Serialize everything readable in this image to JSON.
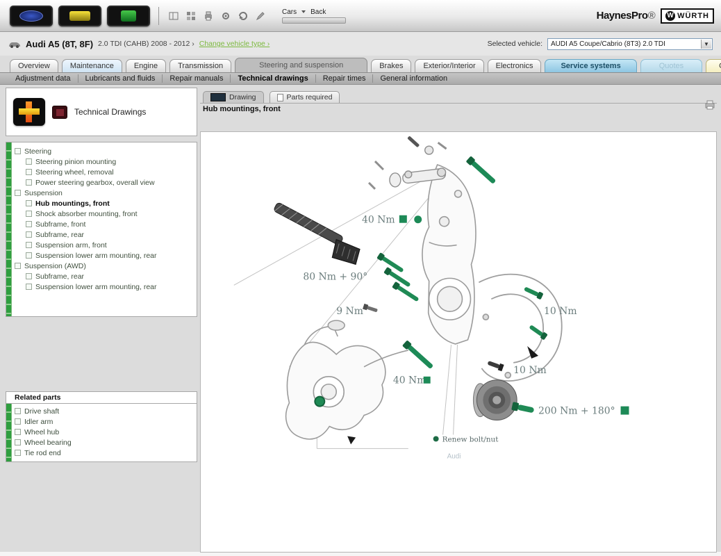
{
  "toolbar": {
    "cars_link": "Cars",
    "back_link": "Back",
    "haynes_logo": "HaynesPro",
    "partner_logo": "WÜRTH",
    "partner_q": "W"
  },
  "vehicle": {
    "title": "Audi A5 (8T, 8F)",
    "subtitle": "2.0 TDI (CAHB) 2008 - 2012 ›",
    "change_link": "Change vehicle type ›",
    "selected_label": "Selected vehicle:",
    "selected_value": "AUDI A5 Coupe/Cabrio (8T3) 2.0 TDI"
  },
  "tabs": [
    {
      "label": "Overview"
    },
    {
      "label": "Maintenance"
    },
    {
      "label": "Engine"
    },
    {
      "label": "Transmission"
    },
    {
      "label": "Steering and suspension"
    },
    {
      "label": "Brakes"
    },
    {
      "label": "Exterior/Interior"
    },
    {
      "label": "Electronics"
    },
    {
      "label": "Service systems"
    },
    {
      "label": "Quotes"
    },
    {
      "label": "Order"
    }
  ],
  "subtabs": [
    {
      "label": "Adjustment data"
    },
    {
      "label": "Lubricants and fluids"
    },
    {
      "label": "Repair manuals"
    },
    {
      "label": "Technical drawings"
    },
    {
      "label": "Repair times"
    },
    {
      "label": "General information"
    }
  ],
  "sidebar": {
    "title": "Technical Drawings",
    "tree": [
      {
        "label": "Steering",
        "items": [
          "Steering pinion mounting",
          "Steering wheel, removal",
          "Power steering gearbox, overall view"
        ]
      },
      {
        "label": "Suspension",
        "items": [
          "Hub mountings, front",
          "Shock absorber mounting, front",
          "Subframe, front",
          "Subframe, rear",
          "Suspension arm, front",
          "Suspension lower arm mounting, rear"
        ]
      },
      {
        "label": "Suspension (AWD)",
        "items": [
          "Subframe, rear",
          "Suspension lower arm mounting, rear"
        ]
      }
    ],
    "related": {
      "title": "Related parts",
      "items": [
        "Drive shaft",
        "Idler arm",
        "Wheel hub",
        "Wheel bearing",
        "Tie rod end"
      ]
    }
  },
  "main": {
    "tabs": [
      {
        "label": "Drawing"
      },
      {
        "label": "Parts required"
      }
    ],
    "title": "Hub mountings, front"
  },
  "drawing": {
    "torques": [
      "40 Nm",
      "80 Nm + 90°",
      "9 Nm",
      "10 Nm",
      "10 Nm",
      "40 Nm",
      "200 Nm + 180°"
    ],
    "legend": "Renew bolt/nut",
    "credit": "Audi",
    "renew_color": "#1d8a57"
  }
}
